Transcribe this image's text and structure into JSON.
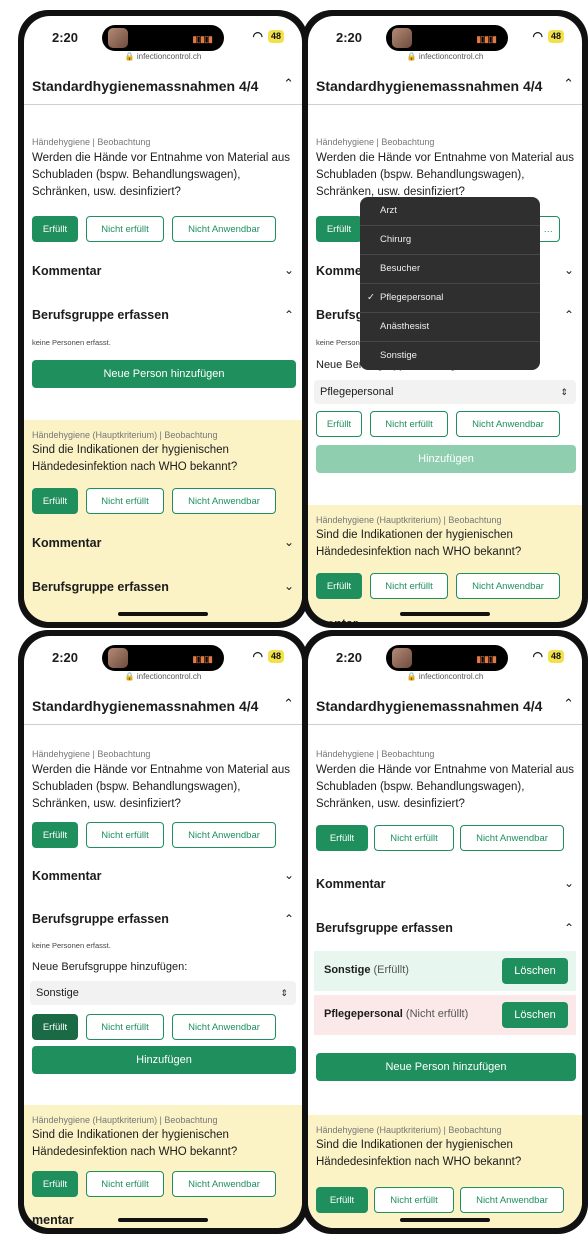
{
  "status": {
    "time": "2:20",
    "battery": "48",
    "url": "infectioncontrol.ch"
  },
  "header": {
    "title": "Standardhygienemassnahmen 4/4"
  },
  "q1": {
    "category": "Händehygiene | Beobachtung",
    "question": "Werden die Hände vor Entnahme von Material aus Schubladen (bspw. Behandlungswagen), Schränken, usw. desinfiziert?"
  },
  "q2": {
    "category": "Händehygiene (Hauptkriterium) | Beobachtung",
    "question": "Sind die Indikationen der hygienischen Händedesinfektion nach WHO bekannt?"
  },
  "buttons": {
    "fulfilled": "Erfüllt",
    "not_fulfilled": "Nicht erfüllt",
    "not_applicable": "Nicht Anwendbar"
  },
  "sections": {
    "comment": "Kommentar",
    "occupation": "Berufsgruppe erfassen",
    "comment_cut": "mentar"
  },
  "no_persons": "keine Personen erfasst.",
  "add_person": "Neue Person hinzufügen",
  "add_group_label": "Neue Berufsgruppe hinzufügen:",
  "add_btn": "Hinzufügen",
  "delete_btn": "Löschen",
  "select_values": {
    "panel2": "Pflegepersonal",
    "panel3": "Sonstige"
  },
  "menu": {
    "options": [
      "Arzt",
      "Chirurg",
      "Besucher",
      "Pflegepersonal",
      "Anästhesist",
      "Sonstige"
    ],
    "selected": "Pflegepersonal",
    "check": "✓"
  },
  "persons": [
    {
      "name": "Sonstige",
      "status": "(Erfüllt)"
    },
    {
      "name": "Pflegepersonal",
      "status": "(Nicht erfüllt)"
    }
  ],
  "colors": {
    "primary": "#1f8f5d",
    "yellow_bg": "#fbf2c6"
  }
}
